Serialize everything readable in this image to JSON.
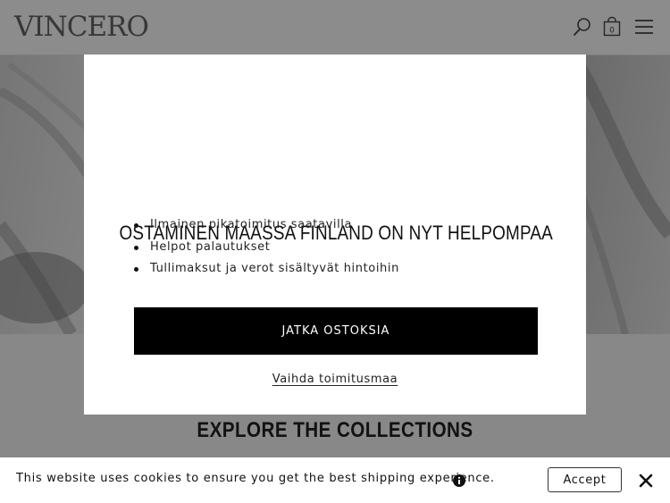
{
  "header": {
    "logo": "VINCERO",
    "cart_count": "0",
    "icons": [
      "search-icon",
      "shopping-bag-icon",
      "hamburger-menu-icon"
    ]
  },
  "collections": {
    "title": "EXPLORE THE COLLECTIONS"
  },
  "modal": {
    "title": "OSTAMINEN MAASSA FINLAND ON NYT HELPOMPAA",
    "benefits": [
      "Ilmainen pikatoimitus saatavilla",
      "Helpot palautukset",
      "Tullimaksut ja verot sisältyvät hintoihin"
    ],
    "continue_label": "JATKA OSTOKSIA",
    "change_country_label": "Vaihda toimitusmaa"
  },
  "cookie_bar": {
    "message": "This website uses cookies to ensure you get the best shipping experience.",
    "accept_label": "Accept",
    "icons": [
      "info-icon",
      "close-icon"
    ]
  },
  "colors": {
    "overlay": "#000000",
    "button_bg": "#000000",
    "button_text": "#ffffff"
  }
}
